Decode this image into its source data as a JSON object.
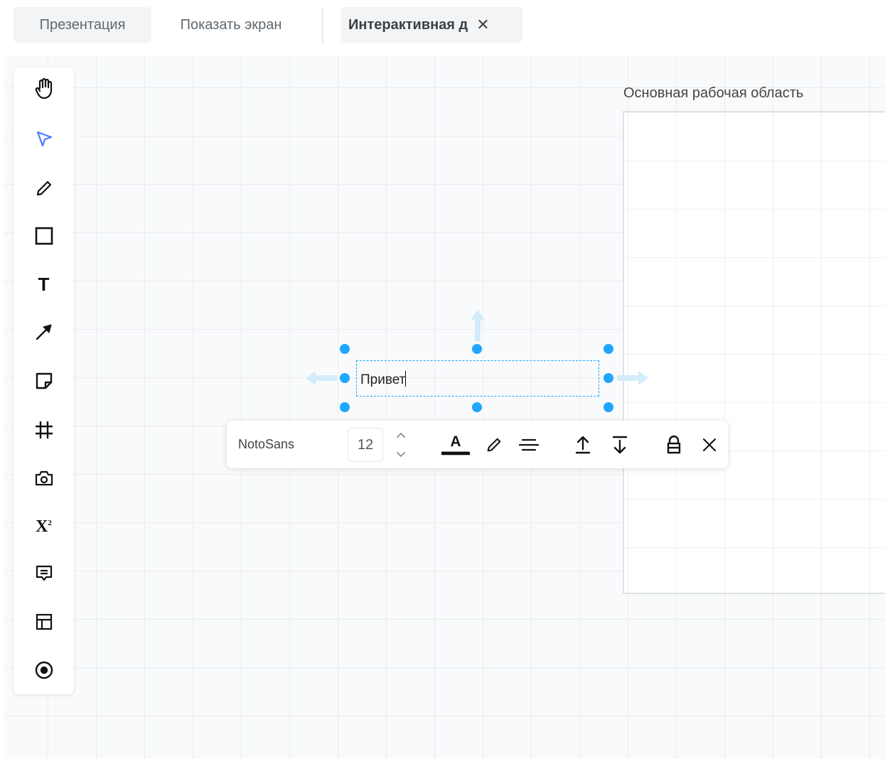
{
  "tabs": {
    "presentation": "Презентация",
    "show_screen": "Показать экран",
    "active_board": "Интерактивная д"
  },
  "toolbar": {
    "tools": [
      {
        "name": "hand-icon"
      },
      {
        "name": "select-pointer-icon",
        "active": true
      },
      {
        "name": "pencil-icon"
      },
      {
        "name": "rectangle-icon"
      },
      {
        "name": "text-icon",
        "glyph": "T"
      },
      {
        "name": "arrow-icon"
      },
      {
        "name": "sticky-note-icon"
      },
      {
        "name": "frame-icon"
      },
      {
        "name": "camera-icon"
      },
      {
        "name": "formula-icon",
        "glyph": "X²"
      },
      {
        "name": "comment-icon"
      },
      {
        "name": "template-icon"
      },
      {
        "name": "record-icon"
      }
    ],
    "active_color": "#4a7cff"
  },
  "workspace": {
    "label": "Основная рабочая область"
  },
  "textbox": {
    "value": "Привет"
  },
  "text_toolbar": {
    "font_family": "NotoSans",
    "font_size": "12"
  },
  "colors": {
    "selection": "#1ea7fd",
    "arrow_hint": "#d3ecfb",
    "canvas_bg": "#f9fafb"
  }
}
